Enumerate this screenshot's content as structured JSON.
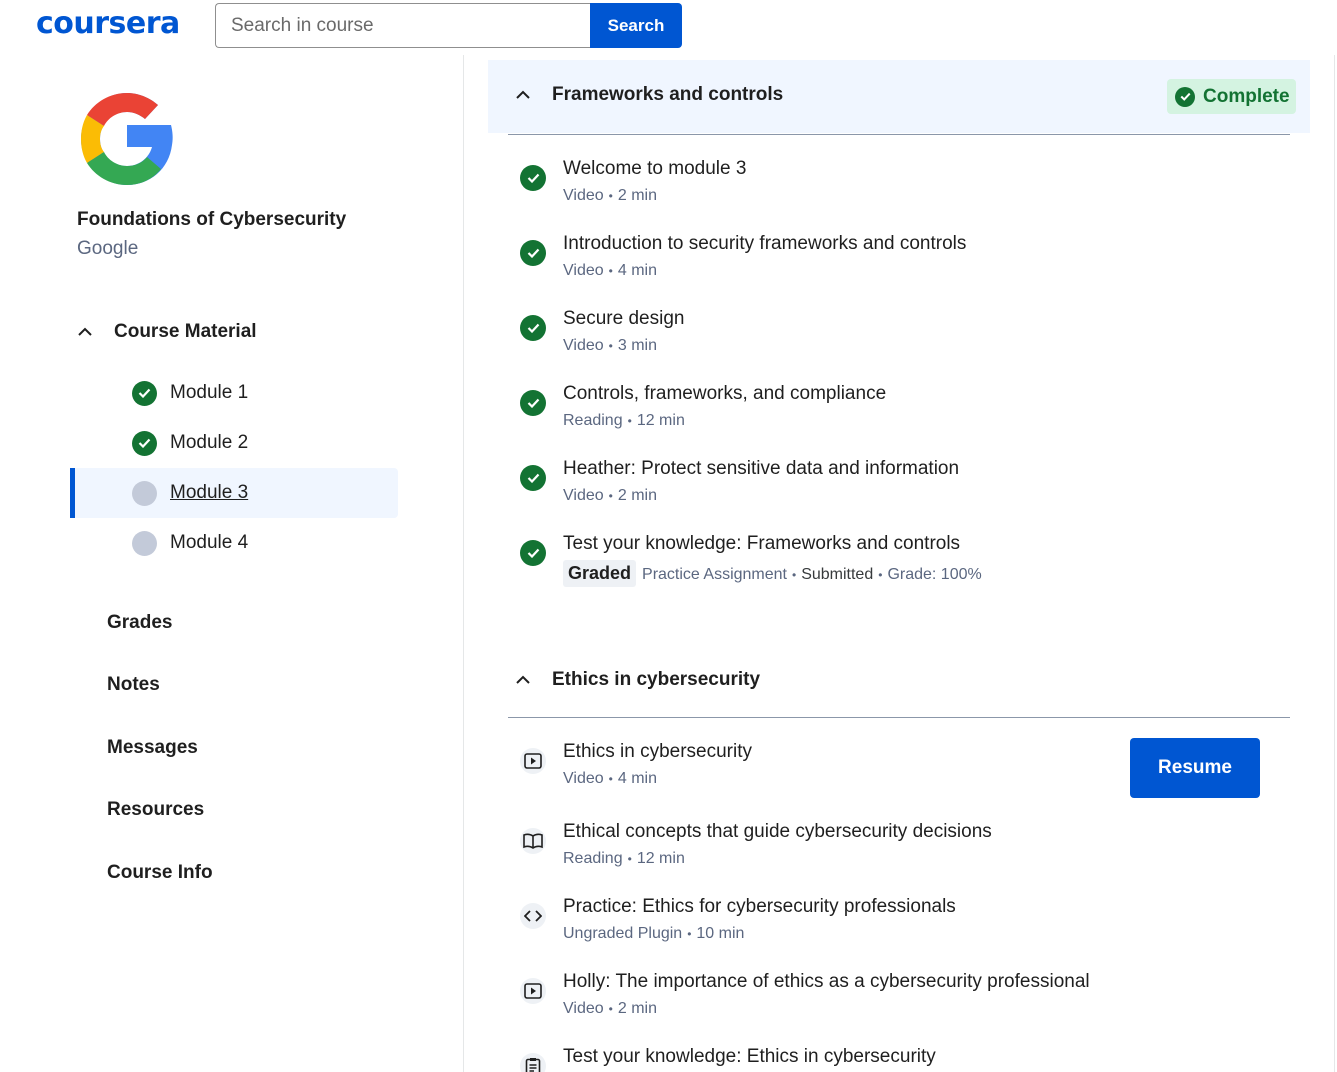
{
  "header": {
    "logo": "coursera",
    "search_placeholder": "Search in course",
    "search_button": "Search"
  },
  "sidebar": {
    "course_title": "Foundations of Cybersecurity",
    "course_partner": "Google",
    "course_material_label": "Course Material",
    "modules": [
      {
        "label": "Module 1",
        "status": "complete"
      },
      {
        "label": "Module 2",
        "status": "complete"
      },
      {
        "label": "Module 3",
        "status": "in-progress",
        "selected": true
      },
      {
        "label": "Module 4",
        "status": "not-started"
      }
    ],
    "nav": [
      "Grades",
      "Notes",
      "Messages",
      "Resources",
      "Course Info"
    ]
  },
  "main": {
    "sections": [
      {
        "title": "Frameworks and controls",
        "badge": "Complete",
        "items": [
          {
            "title": "Welcome to module 3",
            "type": "Video",
            "duration": "2 min",
            "icon": "check-icon"
          },
          {
            "title": "Introduction to security frameworks and controls",
            "type": "Video",
            "duration": "4 min",
            "icon": "check-icon"
          },
          {
            "title": "Secure design",
            "type": "Video",
            "duration": "3 min",
            "icon": "check-icon"
          },
          {
            "title": "Controls, frameworks, and compliance",
            "type": "Reading",
            "duration": "12 min",
            "icon": "check-icon"
          },
          {
            "title": "Heather: Protect sensitive data and information",
            "type": "Video",
            "duration": "2 min",
            "icon": "check-icon"
          },
          {
            "title": "Test your knowledge: Frameworks and controls",
            "graded": "Graded",
            "type": "Practice Assignment",
            "status": "Submitted",
            "grade": "Grade: 100%",
            "icon": "check-icon"
          }
        ]
      },
      {
        "title": "Ethics in cybersecurity",
        "resume_label": "Resume",
        "items": [
          {
            "title": "Ethics in cybersecurity",
            "type": "Video",
            "duration": "4 min",
            "icon": "video-icon"
          },
          {
            "title": "Ethical concepts that guide cybersecurity decisions",
            "type": "Reading",
            "duration": "12 min",
            "icon": "reading-icon"
          },
          {
            "title": "Practice: Ethics for cybersecurity professionals",
            "type": "Ungraded Plugin",
            "duration": "10 min",
            "icon": "code-icon"
          },
          {
            "title": "Holly: The importance of ethics as a cybersecurity professional",
            "type": "Video",
            "duration": "2 min",
            "icon": "video-icon"
          },
          {
            "title": "Test your knowledge: Ethics in cybersecurity",
            "icon": "quiz-icon"
          }
        ]
      }
    ]
  },
  "colors": {
    "brand": "#0056d2",
    "success": "#137333",
    "pending": "#c3cad9",
    "highlight": "#f0f6ff"
  }
}
